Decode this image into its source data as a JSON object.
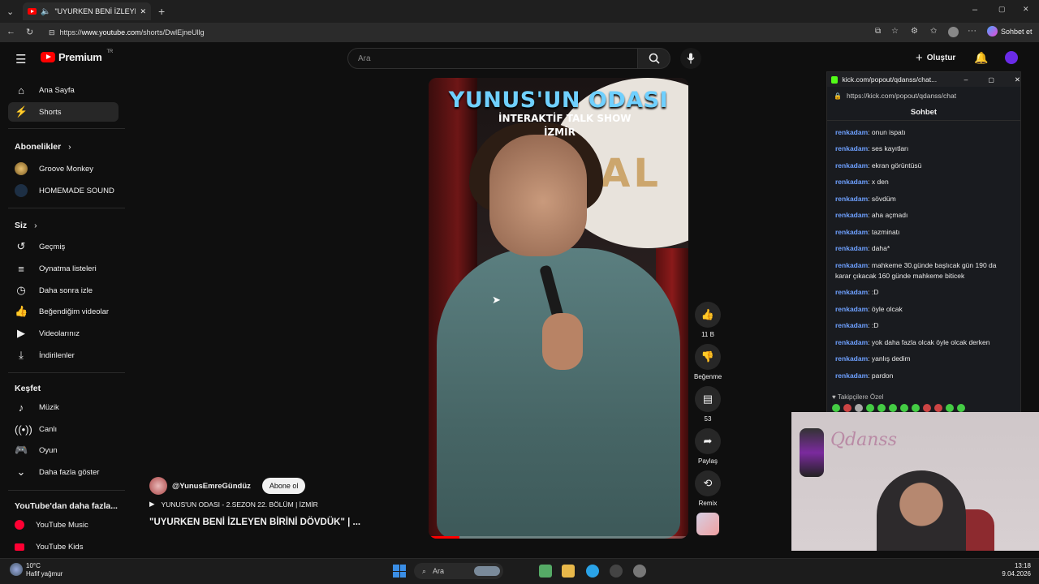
{
  "browser": {
    "tab_title": "\"UYURKEN BENİ İZLEYEN BİRİ",
    "url_prefix": "https://",
    "url_domain": "www.youtube.com",
    "url_path": "/shorts/DwlEjneUllg",
    "copilot_label": "Sohbet et"
  },
  "yt": {
    "logo_text": "Premium",
    "logo_region": "TR",
    "search_placeholder": "Ara",
    "create_label": "Oluştur"
  },
  "sidebar": {
    "home": "Ana Sayfa",
    "shorts": "Shorts",
    "subs_header": "Abonelikler",
    "subs": [
      "Groove Monkey",
      "HOMEMADE SOUND"
    ],
    "you_header": "Siz",
    "you_items": [
      "Geçmiş",
      "Oynatma listeleri",
      "Daha sonra izle",
      "Beğendiğim videolar",
      "Videolarınız",
      "İndirilenler"
    ],
    "explore_header": "Keşfet",
    "explore_items": [
      "Müzik",
      "Canlı",
      "Oyun",
      "Daha fazla göster"
    ],
    "more_header": "YouTube'dan daha fazla...",
    "more_items": [
      "YouTube Music",
      "YouTube Kids"
    ]
  },
  "video": {
    "overlay_title": "YUNUS'UN ODASI",
    "overlay_sub": "İNTERAKTİF TALK SHOW",
    "overlay_city": "İZMİR",
    "progress": 0.12,
    "channel": "@YunusEmreGündüz",
    "subscribe": "Abone ol",
    "playlist": "YUNUS'UN ODASI - 2.SEZON 22. BÖLÜM | İZMİR",
    "title": "\"UYURKEN BENİ İZLEYEN BİRİNİ DÖVDÜK\" | ...",
    "likes": "11 B",
    "dislike_label": "Beğenme",
    "comments": "53",
    "share_label": "Paylaş",
    "remix_label": "Remix"
  },
  "chat": {
    "window_title": "kick.com/popout/qdanss/chat...",
    "url": "https://kick.com/popout/qdanss/chat",
    "tab": "Sohbet",
    "user": "renkadam",
    "messages": [
      "onun ispatı",
      "ses kayıtları",
      "ekran görüntüsü",
      "x den",
      "sövdüm",
      "aha açmadı",
      "tazminatı",
      "daha*",
      "mahkeme 30.günde başlıcak gün 190 da karar çıkacak 160 günde mahkeme biticek",
      ":D",
      "öyle olcak",
      ":D",
      "yok daha fazla olcak öyle olcak derken",
      "yanlış dedim",
      "pardon"
    ],
    "footer": "Takipçilere Özel"
  },
  "cam": {
    "name": "Qdanss"
  },
  "taskbar": {
    "temp": "10°C",
    "weather": "Hafif yağmur",
    "search": "Ara",
    "time": "13:18",
    "date": "9.04.2026"
  }
}
